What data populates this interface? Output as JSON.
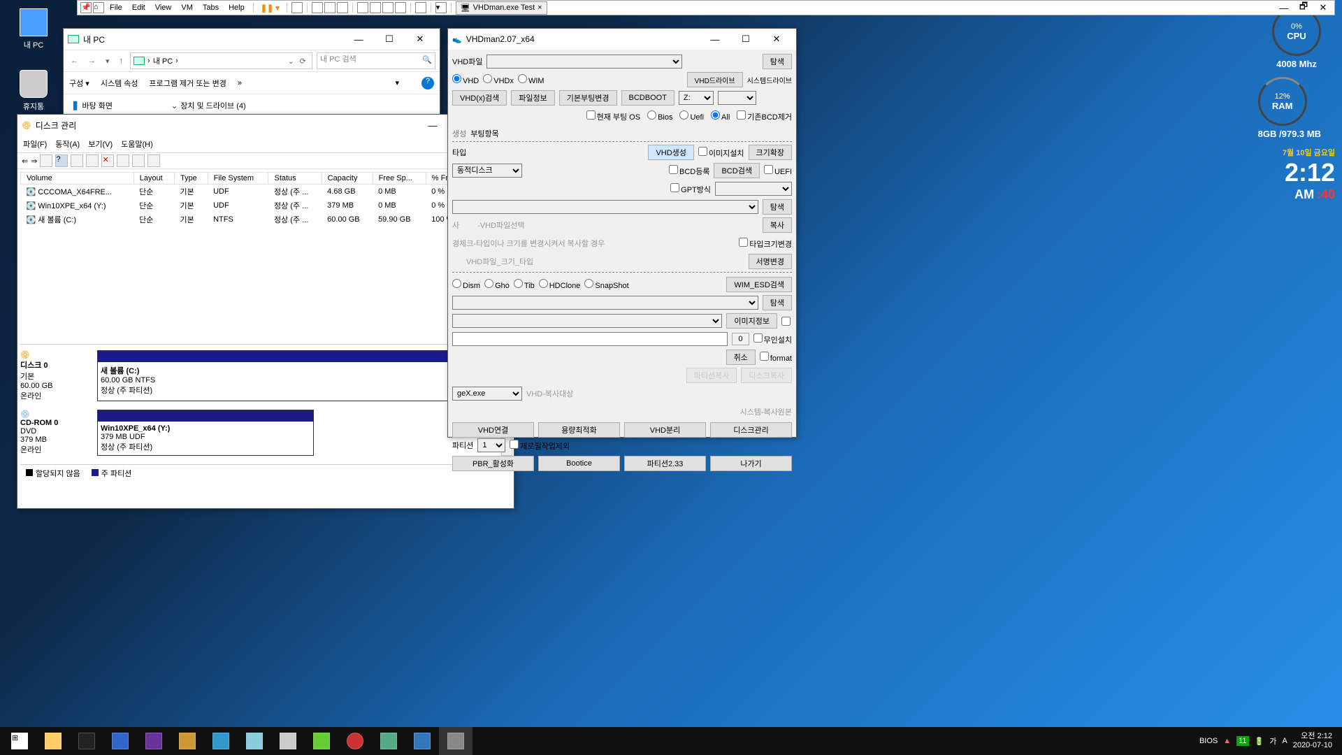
{
  "desktop": {
    "mypc": "내 PC",
    "recycle": "휴지통"
  },
  "widgets": {
    "cpu_pct": "0%",
    "cpu_label": "CPU",
    "cpu_freq": "4008 Mhz",
    "ram_pct": "12%",
    "ram_label": "RAM",
    "ram_total": "8GB /979.3 MB",
    "date": "7월 10일 금요일",
    "time": "2:12",
    "ampm": "AM",
    "seconds": ":40"
  },
  "vm_menu": {
    "file": "File",
    "edit": "Edit",
    "view": "View",
    "vm": "VM",
    "tabs": "Tabs",
    "help": "Help",
    "tab_title": "VHDman.exe Test"
  },
  "explorer": {
    "title": "내 PC",
    "address": "내 PC",
    "search_placeholder": "내 PC 검색",
    "menu_org": "구성 ▾",
    "menu_sys": "시스템 속성",
    "menu_uninstall": "프로그램 제거 또는 변경",
    "tree_desktop": "바탕 화면",
    "tree_devices": "장치 및 드라이브 (4)"
  },
  "diskmgmt": {
    "title": "디스크 관리",
    "menu_file": "파일(F)",
    "menu_action": "동작(A)",
    "menu_view": "보기(V)",
    "menu_help": "도움말(H)",
    "cols": {
      "volume": "Volume",
      "layout": "Layout",
      "type": "Type",
      "fs": "File System",
      "status": "Status",
      "capacity": "Capacity",
      "free": "Free Sp...",
      "pctfree": "% Free"
    },
    "rows": [
      {
        "volume": "CCCOMA_X64FRE...",
        "layout": "단순",
        "type": "기본",
        "fs": "UDF",
        "status": "정상 (주 ...",
        "capacity": "4.68 GB",
        "free": "0 MB",
        "pctfree": "0 %"
      },
      {
        "volume": "Win10XPE_x64 (Y:)",
        "layout": "단순",
        "type": "기본",
        "fs": "UDF",
        "status": "정상 (주 ...",
        "capacity": "379 MB",
        "free": "0 MB",
        "pctfree": "0 %"
      },
      {
        "volume": "새 볼륨 (C:)",
        "layout": "단순",
        "type": "기본",
        "fs": "NTFS",
        "status": "정상 (주 ...",
        "capacity": "60.00 GB",
        "free": "59.90 GB",
        "pctfree": "100 %"
      }
    ],
    "disk0": {
      "name": "디스크 0",
      "type": "기본",
      "size": "60.00 GB",
      "state": "온라인",
      "part_name": "새 볼륨  (C:)",
      "part_size": "60.00 GB NTFS",
      "part_status": "정상 (주 파티션)"
    },
    "cdrom": {
      "name": "CD-ROM 0",
      "type": "DVD",
      "size": "379 MB",
      "state": "온라인",
      "part_name": "Win10XPE_x64   (Y:)",
      "part_size": "379 MB UDF",
      "part_status": "정상 (주 파티션)"
    },
    "legend_unalloc": "할당되지 않음",
    "legend_primary": "주 파티션"
  },
  "vhdman": {
    "title": "VHDman2.07_x64",
    "lbl_vhdfile": "VHD파일",
    "opt_vhd": "VHD",
    "opt_vhdx": "VHDx",
    "opt_wim": "WIM",
    "btn_search": "탐색",
    "btn_vhdx_search": "VHD(x)검색",
    "btn_fileinfo": "파일정보",
    "btn_bootchange": "기본부팅변경",
    "btn_bcdboot": "BCDBOOT",
    "lbl_vhddrive": "VHD드라이브",
    "lbl_sysdrive": "시스템드라이브",
    "drive_z": "Z:",
    "chk_currentboot": "현재 부팅 OS",
    "opt_bios": "Bios",
    "opt_uefi": "Uefi",
    "opt_all": "All",
    "chk_bcdremove": "기존BCD제거",
    "tab_bootitems": "부팅항목",
    "tab_create": "생성",
    "lbl_type": "타입",
    "btn_vhdcreate": "VHD생성",
    "chk_imageinstall": "이미지설치",
    "btn_sizeext": "크기확장",
    "sel_dyndisk": "동적디스크",
    "chk_bcdreg": "BCD등록",
    "btn_bcdsearch": "BCD검색",
    "chk_uefi": "UEFI",
    "chk_gpt": "GPT방식",
    "placeholder_vhdsel": "-VHD파일선택",
    "placeholder_hint1": "경체크-타입이나 크기를 변경시켜서 복사할 경우",
    "placeholder_hint2": "VHD파일_크기_타입",
    "placeholder_copy": "사",
    "btn_copy": "복사",
    "chk_typesize": "타입크기변경",
    "btn_descchange": "서명변경",
    "opt_dism": "Dism",
    "opt_gho": "Gho",
    "opt_tib": "Tib",
    "opt_hdclone": "HDClone",
    "opt_snapshot": "SnapShot",
    "btn_wimesd": "WIM_ESD검색",
    "btn_imageinfo": "이미지정보",
    "chk_noinstall": "무인설치",
    "val_zero": "0",
    "btn_cancel": "취소",
    "chk_format": "format",
    "btn_partcopy": "파티션복사",
    "btn_diskcopy": "디스크복사",
    "sel_gex": "geX.exe",
    "placeholder_copytarget": "VHD-복사대상",
    "placeholder_copysrc": "시스템-복사원본",
    "btn_vhdconn": "VHD연결",
    "btn_capacity": "용량최적화",
    "btn_vhdsep": "VHD분리",
    "btn_diskmgmt": "디스크관리",
    "lbl_partition": "파티션",
    "sel_partnum": "1",
    "chk_zerofill": "제로필작업제외",
    "btn_pbr": "PBR_활성화",
    "btn_bootice": "Bootice",
    "btn_part233": "파티션2.33",
    "btn_exit": "나가기"
  },
  "taskbar": {
    "bios": "BIOS",
    "temp": "11",
    "time": "오전 2:12",
    "date": "2020-07-10"
  }
}
